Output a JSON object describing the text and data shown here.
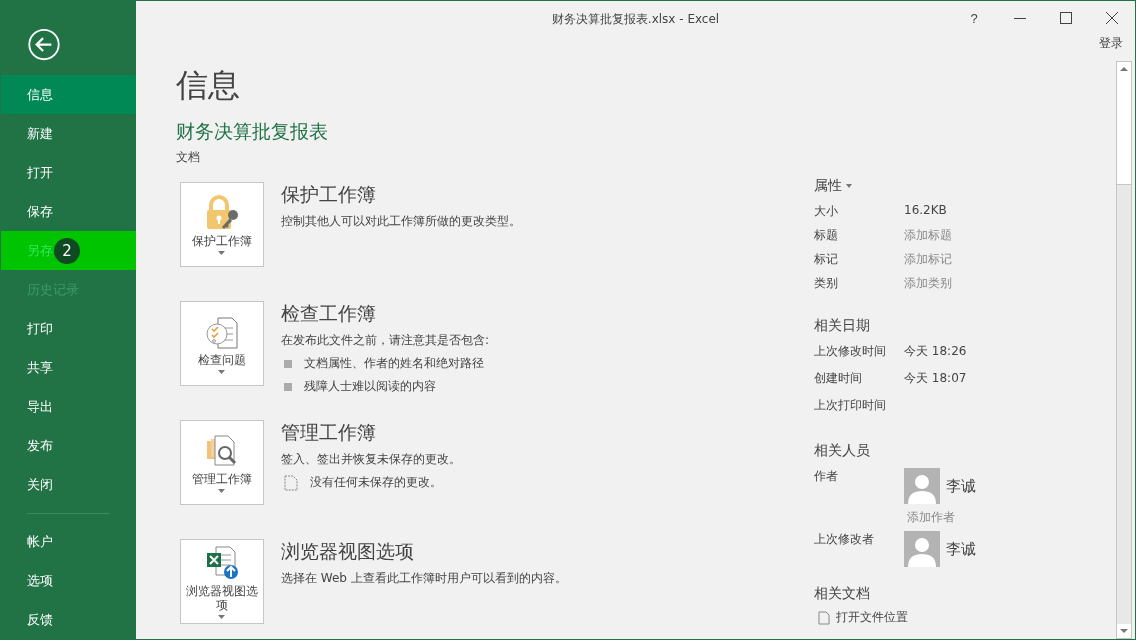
{
  "window": {
    "title": "财务决算批复报表.xlsx - Excel",
    "help": "?",
    "sign_in": "登录"
  },
  "sidebar": {
    "items": [
      {
        "label": "信息",
        "selected": true,
        "highlighted": false,
        "disabled": false
      },
      {
        "label": "新建",
        "selected": false,
        "highlighted": false,
        "disabled": false
      },
      {
        "label": "打开",
        "selected": false,
        "highlighted": false,
        "disabled": false
      },
      {
        "label": "保存",
        "selected": false,
        "highlighted": false,
        "disabled": false
      },
      {
        "label": "另存",
        "selected": false,
        "highlighted": true,
        "disabled": false,
        "step_badge": "2"
      },
      {
        "label": "历史记录",
        "selected": false,
        "highlighted": false,
        "disabled": true
      },
      {
        "label": "打印",
        "selected": false,
        "highlighted": false,
        "disabled": false
      },
      {
        "label": "共享",
        "selected": false,
        "highlighted": false,
        "disabled": false
      },
      {
        "label": "导出",
        "selected": false,
        "highlighted": false,
        "disabled": false
      },
      {
        "label": "发布",
        "selected": false,
        "highlighted": false,
        "disabled": false
      },
      {
        "label": "关闭",
        "selected": false,
        "highlighted": false,
        "disabled": false
      }
    ],
    "bottom_items": [
      {
        "label": "帐户",
        "selected": false,
        "highlighted": false,
        "disabled": false
      },
      {
        "label": "选项",
        "selected": false,
        "highlighted": false,
        "disabled": false
      },
      {
        "label": "反馈",
        "selected": false,
        "highlighted": false,
        "disabled": false
      }
    ]
  },
  "page": {
    "heading": "信息",
    "document_title": "财务决算批复报表",
    "location": "文档"
  },
  "sections": [
    {
      "kind": "protect",
      "button": "保护工作簿",
      "title": "保护工作簿",
      "description": "控制其他人可以对此工作簿所做的更改类型。"
    },
    {
      "kind": "inspect",
      "button": "检查问题",
      "title": "检查工作簿",
      "description": "在发布此文件之前，请注意其是否包含:",
      "bullets": [
        "文档属性、作者的姓名和绝对路径",
        "残障人士难以阅读的内容"
      ]
    },
    {
      "kind": "manage",
      "button": "管理工作簿",
      "title": "管理工作簿",
      "description": "签入、签出并恢复未保存的更改。",
      "note": "没有任何未保存的更改。"
    },
    {
      "kind": "browser",
      "button": "浏览器视图选项",
      "title": "浏览器视图选项",
      "description": "选择在 Web 上查看此工作簿时用户可以看到的内容。"
    }
  ],
  "properties": {
    "heading": "属性",
    "rows": [
      {
        "label": "大小",
        "value": "16.2KB"
      },
      {
        "label": "标题",
        "placeholder": "添加标题"
      },
      {
        "label": "标记",
        "placeholder": "添加标记"
      },
      {
        "label": "类别",
        "placeholder": "添加类别"
      }
    ]
  },
  "dates": {
    "heading": "相关日期",
    "rows": [
      {
        "label": "上次修改时间",
        "value": "今天 18:26"
      },
      {
        "label": "创建时间",
        "value": "今天 18:07"
      },
      {
        "label": "上次打印时间"
      }
    ]
  },
  "people": {
    "heading": "相关人员",
    "rows": [
      {
        "label": "作者",
        "name": "李诚",
        "placeholder": "添加作者"
      },
      {
        "label": "上次修改者",
        "name": "李诚"
      }
    ]
  },
  "documents": {
    "heading": "相关文档",
    "links": [
      "打开文件位置"
    ]
  }
}
